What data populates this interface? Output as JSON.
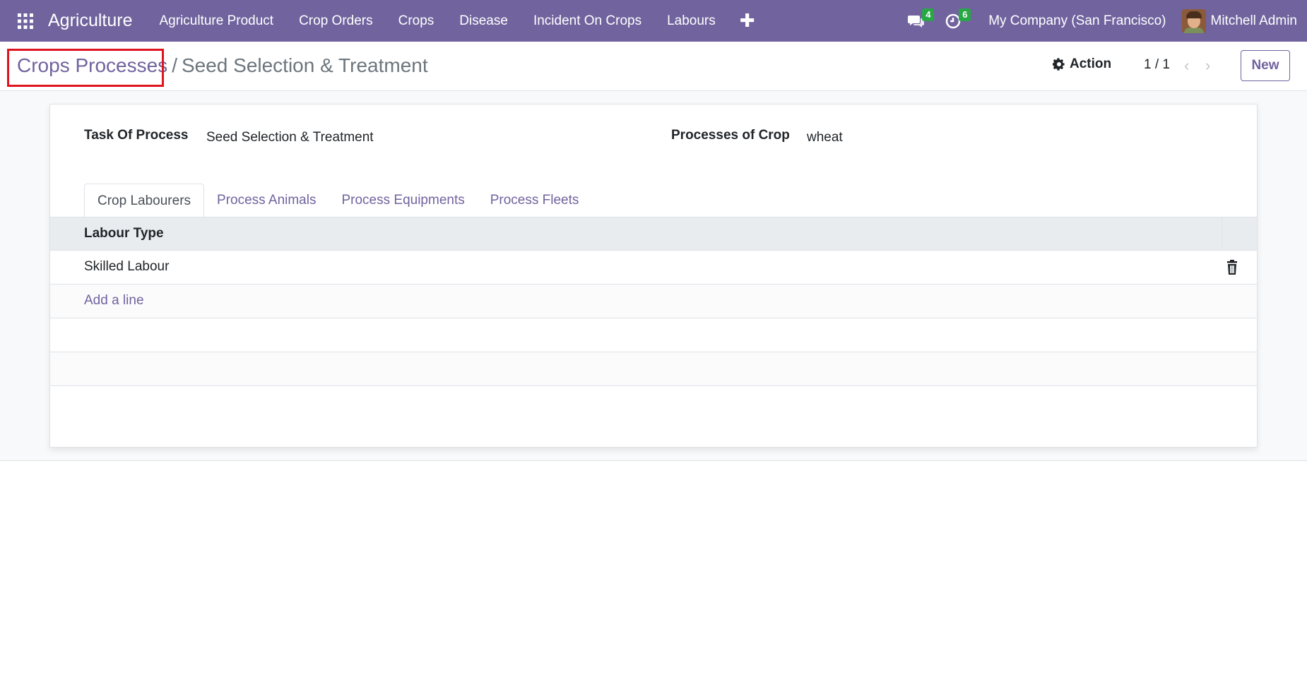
{
  "navbar": {
    "brand": "Agriculture",
    "menu": [
      {
        "label": "Agriculture Product"
      },
      {
        "label": "Crop Orders"
      },
      {
        "label": "Crops"
      },
      {
        "label": "Disease"
      },
      {
        "label": "Incident On Crops"
      },
      {
        "label": "Labours"
      }
    ],
    "plus_label": "✚",
    "messages_count": "4",
    "activities_count": "6",
    "company": "My Company (San Francisco)",
    "user_name": "Mitchell Admin"
  },
  "breadcrumb": {
    "parent": "Crops Processes",
    "separator": "/",
    "current": "Seed Selection & Treatment"
  },
  "control": {
    "action_label": "Action",
    "pager": "1 / 1",
    "prev_glyph": "‹",
    "next_glyph": "›",
    "new_label": "New"
  },
  "form": {
    "task_label": "Task Of Process",
    "task_value": "Seed Selection & Treatment",
    "crop_label": "Processes of Crop",
    "crop_value": "wheat"
  },
  "tabs": [
    {
      "label": "Crop Labourers",
      "active": true
    },
    {
      "label": "Process Animals"
    },
    {
      "label": "Process Equipments"
    },
    {
      "label": "Process Fleets"
    }
  ],
  "table": {
    "header": "Labour Type",
    "rows": [
      {
        "labour_type": "Skilled Labour"
      }
    ],
    "add_line": "Add a line"
  },
  "colors": {
    "brand": "#71639e",
    "badge": "#28a745",
    "highlight": "#e0141e"
  },
  "icons": {
    "apps": "apps-grid-icon",
    "messages": "chat-icon",
    "activities": "clock-icon",
    "action": "gear-icon",
    "delete": "trash-icon"
  }
}
